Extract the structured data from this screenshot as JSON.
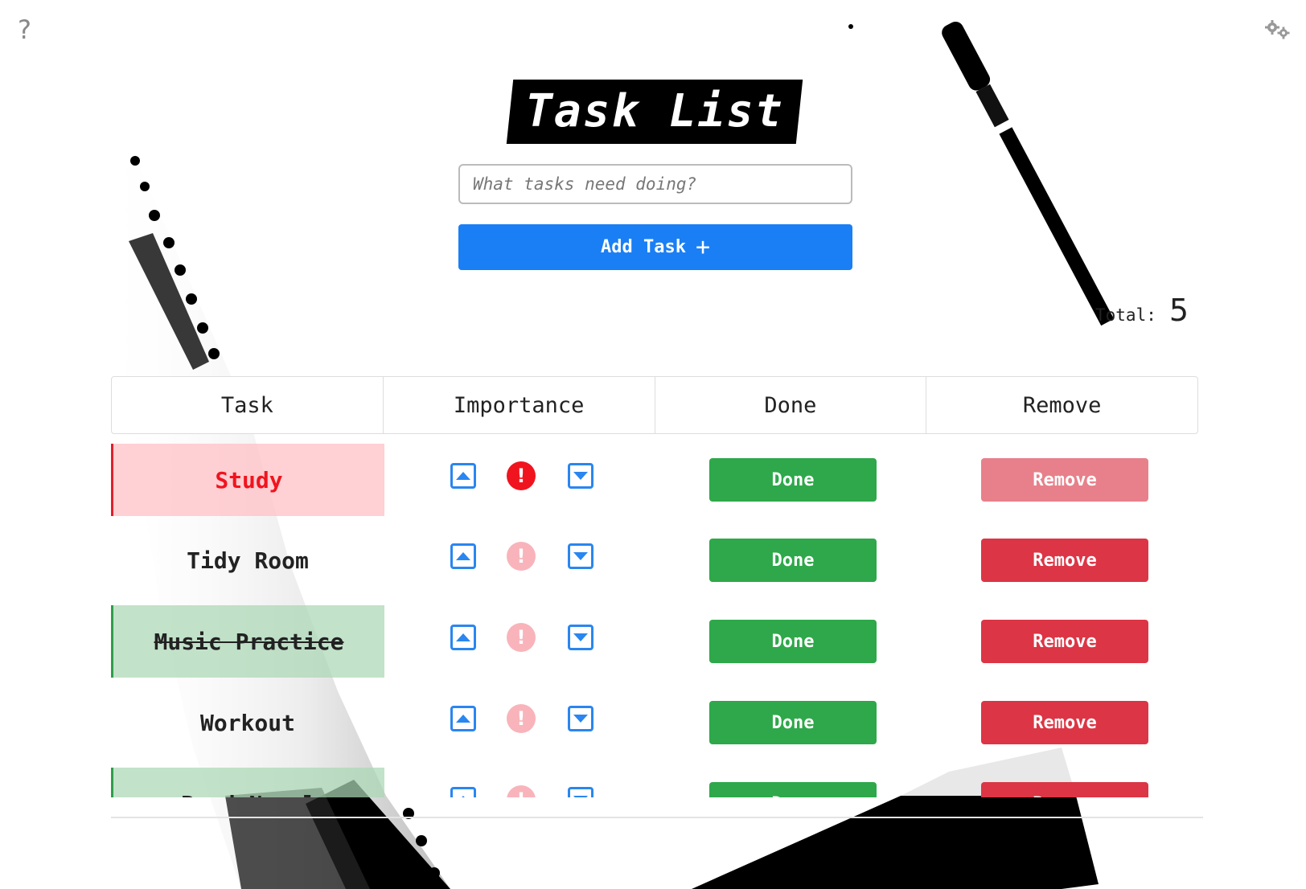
{
  "app": {
    "title": "Task List",
    "input_placeholder": "What tasks need doing?",
    "add_button_label": "Add Task",
    "add_button_icon": "plus-icon",
    "total_label": "Total:",
    "total_value": "5",
    "help_icon": "help-icon",
    "settings_icon": "gear-icon"
  },
  "table": {
    "headers": [
      "Task",
      "Importance",
      "Done",
      "Remove"
    ],
    "rows": [
      {
        "name": "Study",
        "state": "important",
        "done_label": "Done",
        "remove_label": "Remove",
        "important_icon": "!"
      },
      {
        "name": "Tidy Room",
        "state": "normal",
        "done_label": "Done",
        "remove_label": "Remove",
        "important_icon": "!"
      },
      {
        "name": "Music Practice",
        "state": "done",
        "done_label": "Done",
        "remove_label": "Remove",
        "important_icon": "!"
      },
      {
        "name": "Workout",
        "state": "normal",
        "done_label": "Done",
        "remove_label": "Remove",
        "important_icon": "!"
      },
      {
        "name": "Read Novel",
        "state": "done",
        "done_label": "Done",
        "remove_label": "Remove",
        "important_icon": "!"
      }
    ]
  },
  "colors": {
    "accent_blue": "#1a7ff5",
    "done_green": "#2ea84a",
    "remove_red": "#dc3545",
    "important_red": "#f0141e"
  }
}
